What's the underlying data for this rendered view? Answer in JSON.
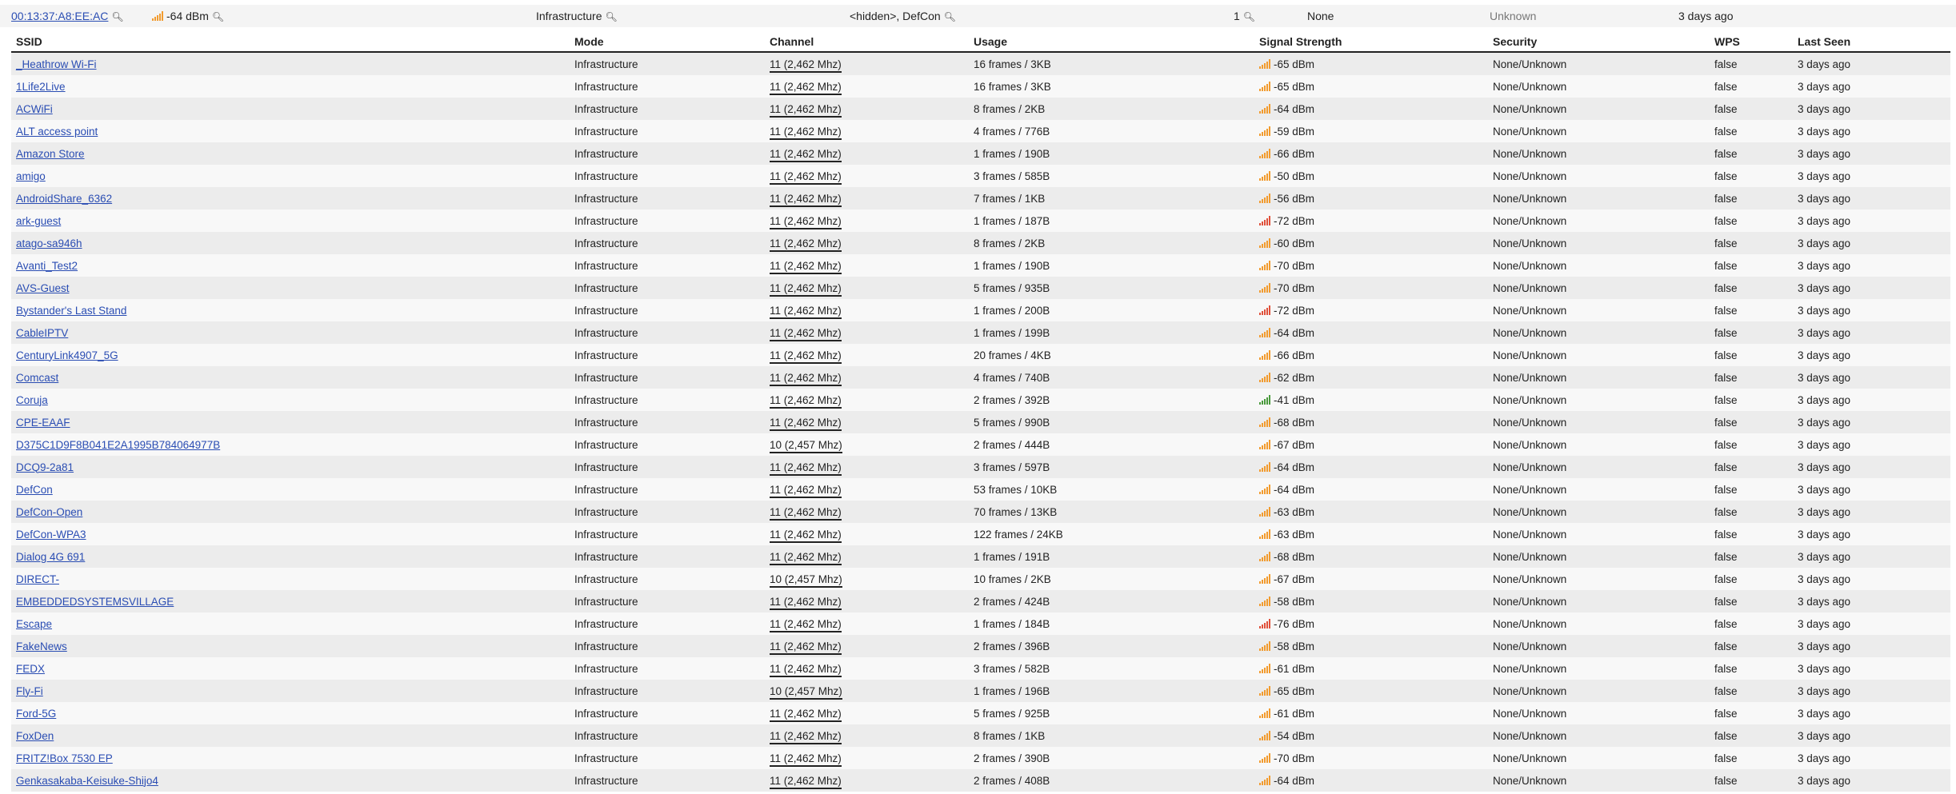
{
  "colors": {
    "link": "#2a4db3",
    "signal_orange": "#f29b2e",
    "signal_red": "#e0503a",
    "signal_green": "#4a9a3c"
  },
  "summary": {
    "mac": "00:13:37:A8:EE:AC",
    "signal": "-64 dBm",
    "mode": "Infrastructure",
    "ssids": "<hidden>, DefCon",
    "count": "1",
    "security": "None",
    "vendor": "Unknown",
    "last_seen": "3 days ago",
    "search_icon": "magnifier-icon"
  },
  "table": {
    "headers": [
      "SSID",
      "Mode",
      "Channel",
      "Usage",
      "Signal Strength",
      "Security",
      "WPS",
      "Last Seen"
    ],
    "rows": [
      {
        "ssid": "_Heathrow Wi-Fi",
        "mode": "Infrastructure",
        "channel": "11 (2,462 Mhz)",
        "usage": "16 frames / 3KB",
        "signal": "-65 dBm",
        "level": "orange",
        "security": "None/Unknown",
        "wps": "false",
        "seen": "3 days ago"
      },
      {
        "ssid": "1Life2Live",
        "mode": "Infrastructure",
        "channel": "11 (2,462 Mhz)",
        "usage": "16 frames / 3KB",
        "signal": "-65 dBm",
        "level": "orange",
        "security": "None/Unknown",
        "wps": "false",
        "seen": "3 days ago"
      },
      {
        "ssid": "ACWiFi",
        "mode": "Infrastructure",
        "channel": "11 (2,462 Mhz)",
        "usage": "8 frames / 2KB",
        "signal": "-64 dBm",
        "level": "orange",
        "security": "None/Unknown",
        "wps": "false",
        "seen": "3 days ago"
      },
      {
        "ssid": "ALT access point",
        "mode": "Infrastructure",
        "channel": "11 (2,462 Mhz)",
        "usage": "4 frames / 776B",
        "signal": "-59 dBm",
        "level": "orange",
        "security": "None/Unknown",
        "wps": "false",
        "seen": "3 days ago"
      },
      {
        "ssid": "Amazon Store",
        "mode": "Infrastructure",
        "channel": "11 (2,462 Mhz)",
        "usage": "1 frames / 190B",
        "signal": "-66 dBm",
        "level": "orange",
        "security": "None/Unknown",
        "wps": "false",
        "seen": "3 days ago"
      },
      {
        "ssid": "amigo",
        "mode": "Infrastructure",
        "channel": "11 (2,462 Mhz)",
        "usage": "3 frames / 585B",
        "signal": "-50 dBm",
        "level": "orange",
        "security": "None/Unknown",
        "wps": "false",
        "seen": "3 days ago"
      },
      {
        "ssid": "AndroidShare_6362",
        "mode": "Infrastructure",
        "channel": "11 (2,462 Mhz)",
        "usage": "7 frames / 1KB",
        "signal": "-56 dBm",
        "level": "orange",
        "security": "None/Unknown",
        "wps": "false",
        "seen": "3 days ago"
      },
      {
        "ssid": "ark-guest",
        "mode": "Infrastructure",
        "channel": "11 (2,462 Mhz)",
        "usage": "1 frames / 187B",
        "signal": "-72 dBm",
        "level": "red",
        "security": "None/Unknown",
        "wps": "false",
        "seen": "3 days ago"
      },
      {
        "ssid": "atago-sa946h",
        "mode": "Infrastructure",
        "channel": "11 (2,462 Mhz)",
        "usage": "8 frames / 2KB",
        "signal": "-60 dBm",
        "level": "orange",
        "security": "None/Unknown",
        "wps": "false",
        "seen": "3 days ago"
      },
      {
        "ssid": "Avanti_Test2",
        "mode": "Infrastructure",
        "channel": "11 (2,462 Mhz)",
        "usage": "1 frames / 190B",
        "signal": "-70 dBm",
        "level": "orange",
        "security": "None/Unknown",
        "wps": "false",
        "seen": "3 days ago"
      },
      {
        "ssid": "AVS-Guest",
        "mode": "Infrastructure",
        "channel": "11 (2,462 Mhz)",
        "usage": "5 frames / 935B",
        "signal": "-70 dBm",
        "level": "orange",
        "security": "None/Unknown",
        "wps": "false",
        "seen": "3 days ago"
      },
      {
        "ssid": "Bystander's Last Stand",
        "mode": "Infrastructure",
        "channel": "11 (2,462 Mhz)",
        "usage": "1 frames / 200B",
        "signal": "-72 dBm",
        "level": "red",
        "security": "None/Unknown",
        "wps": "false",
        "seen": "3 days ago"
      },
      {
        "ssid": "CableIPTV",
        "mode": "Infrastructure",
        "channel": "11 (2,462 Mhz)",
        "usage": "1 frames / 199B",
        "signal": "-64 dBm",
        "level": "orange",
        "security": "None/Unknown",
        "wps": "false",
        "seen": "3 days ago"
      },
      {
        "ssid": "CenturyLink4907_5G",
        "mode": "Infrastructure",
        "channel": "11 (2,462 Mhz)",
        "usage": "20 frames / 4KB",
        "signal": "-66 dBm",
        "level": "orange",
        "security": "None/Unknown",
        "wps": "false",
        "seen": "3 days ago"
      },
      {
        "ssid": "Comcast",
        "mode": "Infrastructure",
        "channel": "11 (2,462 Mhz)",
        "usage": "4 frames / 740B",
        "signal": "-62 dBm",
        "level": "orange",
        "security": "None/Unknown",
        "wps": "false",
        "seen": "3 days ago"
      },
      {
        "ssid": "Coruja",
        "mode": "Infrastructure",
        "channel": "11 (2,462 Mhz)",
        "usage": "2 frames / 392B",
        "signal": "-41 dBm",
        "level": "green",
        "security": "None/Unknown",
        "wps": "false",
        "seen": "3 days ago"
      },
      {
        "ssid": "CPE-EAAF",
        "mode": "Infrastructure",
        "channel": "11 (2,462 Mhz)",
        "usage": "5 frames / 990B",
        "signal": "-68 dBm",
        "level": "orange",
        "security": "None/Unknown",
        "wps": "false",
        "seen": "3 days ago"
      },
      {
        "ssid": "D375C1D9F8B041E2A1995B784064977B",
        "mode": "Infrastructure",
        "channel": "10 (2,457 Mhz)",
        "usage": "2 frames / 444B",
        "signal": "-67 dBm",
        "level": "orange",
        "security": "None/Unknown",
        "wps": "false",
        "seen": "3 days ago"
      },
      {
        "ssid": "DCQ9-2a81",
        "mode": "Infrastructure",
        "channel": "11 (2,462 Mhz)",
        "usage": "3 frames / 597B",
        "signal": "-64 dBm",
        "level": "orange",
        "security": "None/Unknown",
        "wps": "false",
        "seen": "3 days ago"
      },
      {
        "ssid": "DefCon",
        "mode": "Infrastructure",
        "channel": "11 (2,462 Mhz)",
        "usage": "53 frames / 10KB",
        "signal": "-64 dBm",
        "level": "orange",
        "security": "None/Unknown",
        "wps": "false",
        "seen": "3 days ago"
      },
      {
        "ssid": "DefCon-Open",
        "mode": "Infrastructure",
        "channel": "11 (2,462 Mhz)",
        "usage": "70 frames / 13KB",
        "signal": "-63 dBm",
        "level": "orange",
        "security": "None/Unknown",
        "wps": "false",
        "seen": "3 days ago"
      },
      {
        "ssid": "DefCon-WPA3",
        "mode": "Infrastructure",
        "channel": "11 (2,462 Mhz)",
        "usage": "122 frames / 24KB",
        "signal": "-63 dBm",
        "level": "orange",
        "security": "None/Unknown",
        "wps": "false",
        "seen": "3 days ago"
      },
      {
        "ssid": "Dialog 4G 691",
        "mode": "Infrastructure",
        "channel": "11 (2,462 Mhz)",
        "usage": "1 frames / 191B",
        "signal": "-68 dBm",
        "level": "orange",
        "security": "None/Unknown",
        "wps": "false",
        "seen": "3 days ago"
      },
      {
        "ssid": "DIRECT-",
        "mode": "Infrastructure",
        "channel": "10 (2,457 Mhz)",
        "usage": "10 frames / 2KB",
        "signal": "-67 dBm",
        "level": "orange",
        "security": "None/Unknown",
        "wps": "false",
        "seen": "3 days ago"
      },
      {
        "ssid": "EMBEDDEDSYSTEMSVILLAGE",
        "mode": "Infrastructure",
        "channel": "11 (2,462 Mhz)",
        "usage": "2 frames / 424B",
        "signal": "-58 dBm",
        "level": "orange",
        "security": "None/Unknown",
        "wps": "false",
        "seen": "3 days ago"
      },
      {
        "ssid": "Escape",
        "mode": "Infrastructure",
        "channel": "11 (2,462 Mhz)",
        "usage": "1 frames / 184B",
        "signal": "-76 dBm",
        "level": "red",
        "security": "None/Unknown",
        "wps": "false",
        "seen": "3 days ago"
      },
      {
        "ssid": "FakeNews",
        "mode": "Infrastructure",
        "channel": "11 (2,462 Mhz)",
        "usage": "2 frames / 396B",
        "signal": "-58 dBm",
        "level": "orange",
        "security": "None/Unknown",
        "wps": "false",
        "seen": "3 days ago"
      },
      {
        "ssid": "FEDX",
        "mode": "Infrastructure",
        "channel": "11 (2,462 Mhz)",
        "usage": "3 frames / 582B",
        "signal": "-61 dBm",
        "level": "orange",
        "security": "None/Unknown",
        "wps": "false",
        "seen": "3 days ago"
      },
      {
        "ssid": "Fly-Fi",
        "mode": "Infrastructure",
        "channel": "10 (2,457 Mhz)",
        "usage": "1 frames / 196B",
        "signal": "-65 dBm",
        "level": "orange",
        "security": "None/Unknown",
        "wps": "false",
        "seen": "3 days ago"
      },
      {
        "ssid": "Ford-5G",
        "mode": "Infrastructure",
        "channel": "11 (2,462 Mhz)",
        "usage": "5 frames / 925B",
        "signal": "-61 dBm",
        "level": "orange",
        "security": "None/Unknown",
        "wps": "false",
        "seen": "3 days ago"
      },
      {
        "ssid": "FoxDen",
        "mode": "Infrastructure",
        "channel": "11 (2,462 Mhz)",
        "usage": "8 frames / 1KB",
        "signal": "-54 dBm",
        "level": "orange",
        "security": "None/Unknown",
        "wps": "false",
        "seen": "3 days ago"
      },
      {
        "ssid": "FRITZ!Box 7530 EP",
        "mode": "Infrastructure",
        "channel": "11 (2,462 Mhz)",
        "usage": "2 frames / 390B",
        "signal": "-70 dBm",
        "level": "orange",
        "security": "None/Unknown",
        "wps": "false",
        "seen": "3 days ago"
      },
      {
        "ssid": "Genkasakaba-Keisuke-Shijo4",
        "mode": "Infrastructure",
        "channel": "11 (2,462 Mhz)",
        "usage": "2 frames / 408B",
        "signal": "-64 dBm",
        "level": "orange",
        "security": "None/Unknown",
        "wps": "false",
        "seen": "3 days ago"
      }
    ]
  }
}
